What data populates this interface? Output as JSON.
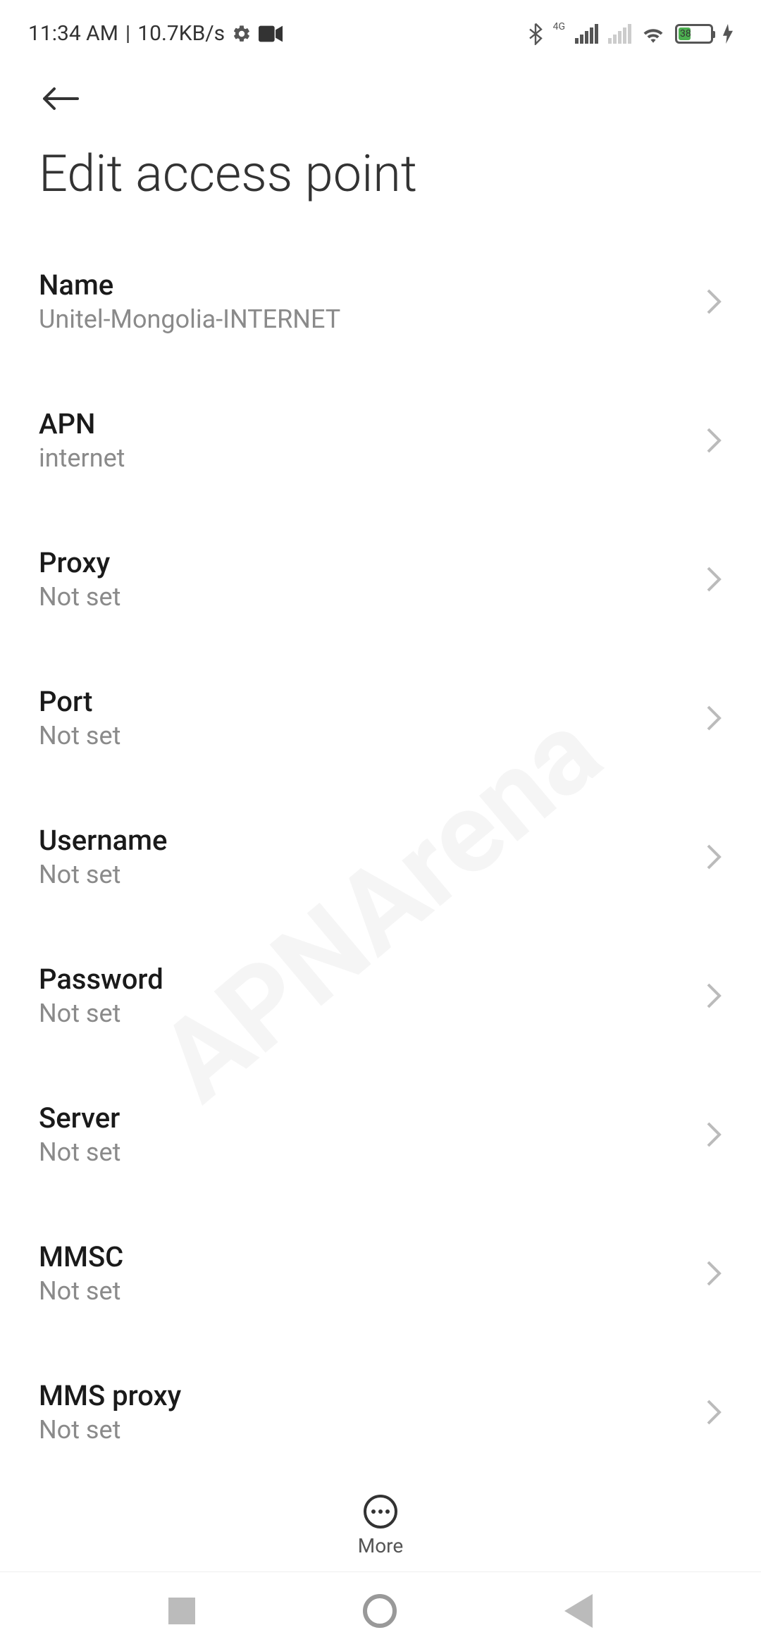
{
  "statusBar": {
    "time": "11:34 AM",
    "separator": "|",
    "dataRate": "10.7KB/s",
    "networkLabel": "4G",
    "batteryLevel": "38"
  },
  "header": {
    "title": "Edit access point"
  },
  "items": [
    {
      "id": "name",
      "title": "Name",
      "value": "Unitel-Mongolia-INTERNET"
    },
    {
      "id": "apn",
      "title": "APN",
      "value": "internet"
    },
    {
      "id": "proxy",
      "title": "Proxy",
      "value": "Not set"
    },
    {
      "id": "port",
      "title": "Port",
      "value": "Not set"
    },
    {
      "id": "username",
      "title": "Username",
      "value": "Not set"
    },
    {
      "id": "password",
      "title": "Password",
      "value": "Not set"
    },
    {
      "id": "server",
      "title": "Server",
      "value": "Not set"
    },
    {
      "id": "mmsc",
      "title": "MMSC",
      "value": "Not set"
    },
    {
      "id": "mmsproxy",
      "title": "MMS proxy",
      "value": "Not set"
    }
  ],
  "bottomBar": {
    "moreLabel": "More"
  },
  "watermark": "APNArena"
}
